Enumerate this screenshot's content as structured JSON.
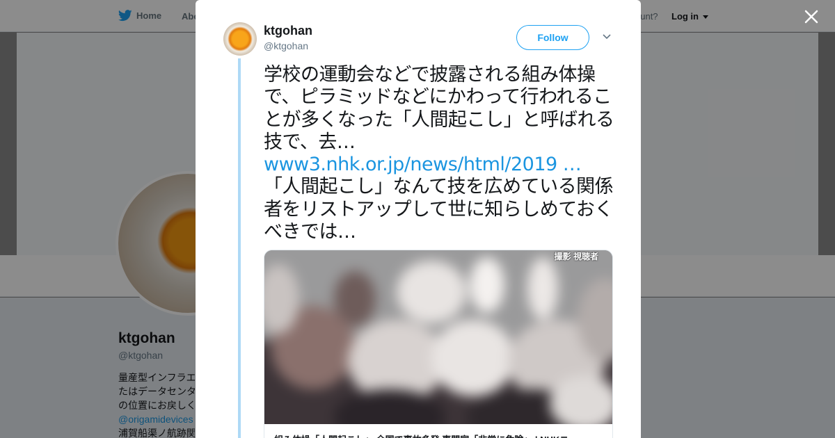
{
  "background": {
    "nav": {
      "home_label": "Home",
      "about_label": "Abo",
      "account_prompt": "ccount?",
      "login_label": "Log in"
    },
    "profile": {
      "name": "ktgohan",
      "handle": "@ktgohan",
      "bio_lines": [
        "量産型インフラエ",
        "たはデータセンタ",
        "の位置にお戻しく"
      ],
      "bio_link": "@origamidevices",
      "bio_last": "浦賀船渠ノ航跡関"
    }
  },
  "modal": {
    "author": {
      "name": "ktgohan",
      "handle": "@ktgohan"
    },
    "follow_label": "Follow",
    "tweet": {
      "text_part1": "学校の運動会などで披露される組み体操で、ピラミッドなどにかわって行われることが多くなった「人間起こし」と呼ばれる技で、去…",
      "link": "www3.nhk.or.jp/news/html/2019 …",
      "text_part2": " 「人間起こし」なんて技を広めている関係者をリストアップして世に知らしめておくべきでは…"
    },
    "card": {
      "image_credit": "撮影 視聴者",
      "title": "組み体操「人間起こし」 全国で事故多発 専門家「非常に危険」 | NHKニ"
    }
  },
  "colors": {
    "accent": "#1da1f2",
    "link": "#1b95e0",
    "thread_line": "#aed9f6"
  }
}
